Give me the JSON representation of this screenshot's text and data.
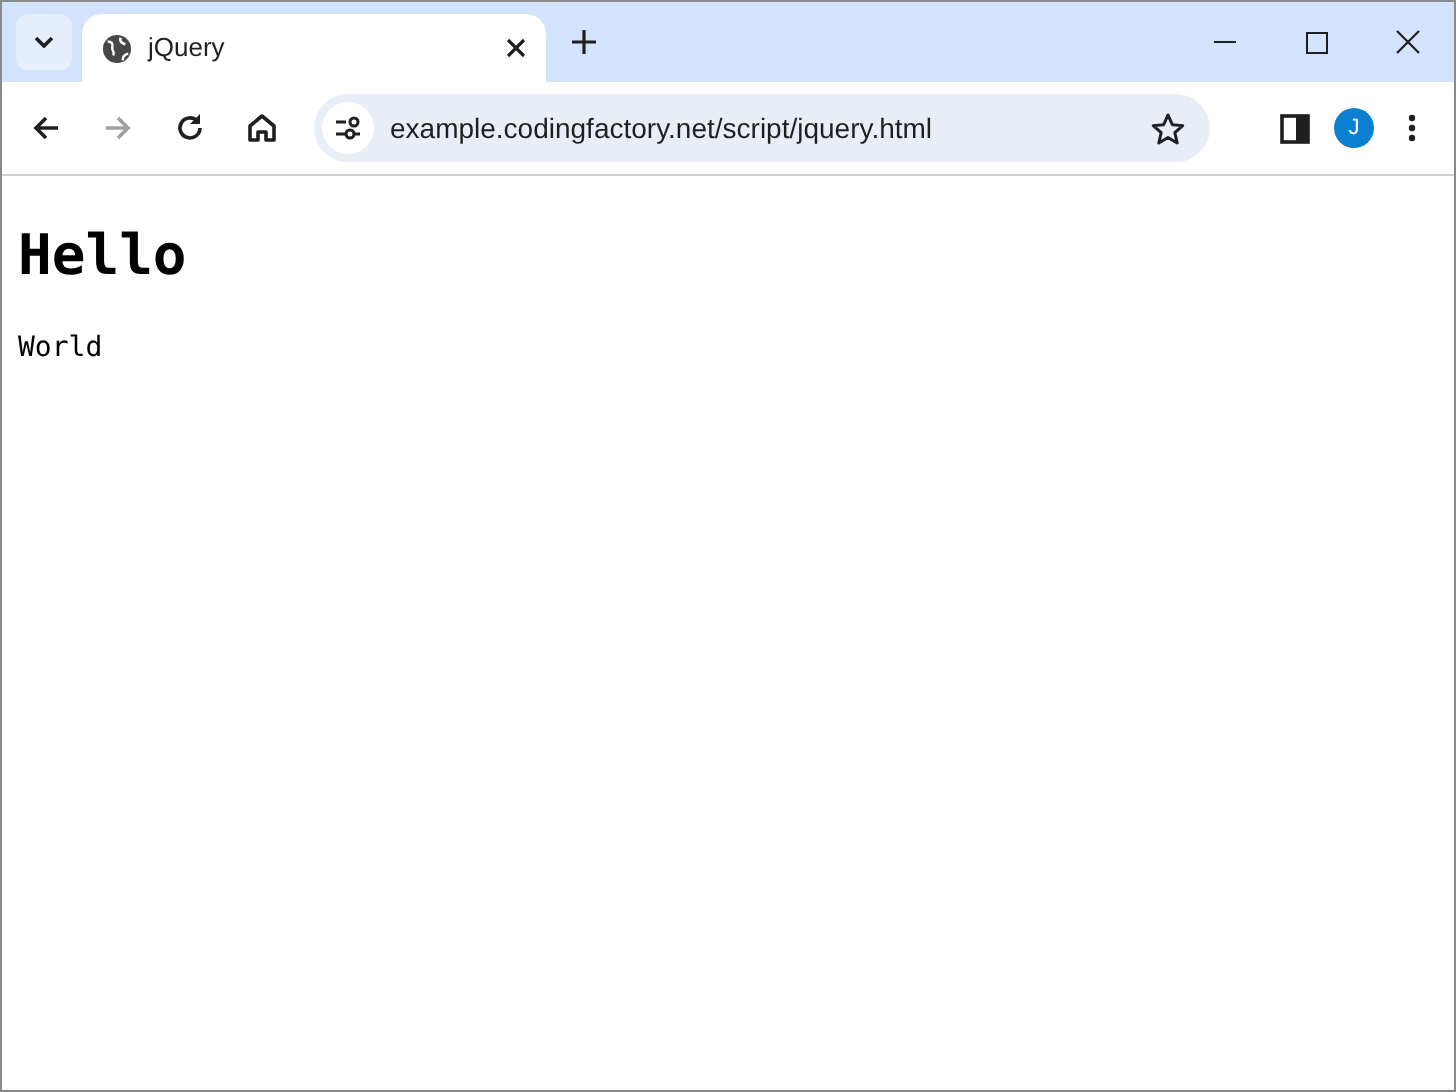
{
  "tabs": [
    {
      "title": "jQuery",
      "selected": true
    }
  ],
  "toolbar": {
    "nav": [
      {
        "kind": "back",
        "disabled": false
      },
      {
        "kind": "forward",
        "disabled": true
      },
      {
        "kind": "reload",
        "disabled": false
      },
      {
        "kind": "home",
        "disabled": false
      }
    ],
    "address": "example.codingfactory.net/script/jquery.html",
    "profile_initial": "J"
  },
  "page": {
    "heading": "Hello",
    "paragraph": "World"
  }
}
